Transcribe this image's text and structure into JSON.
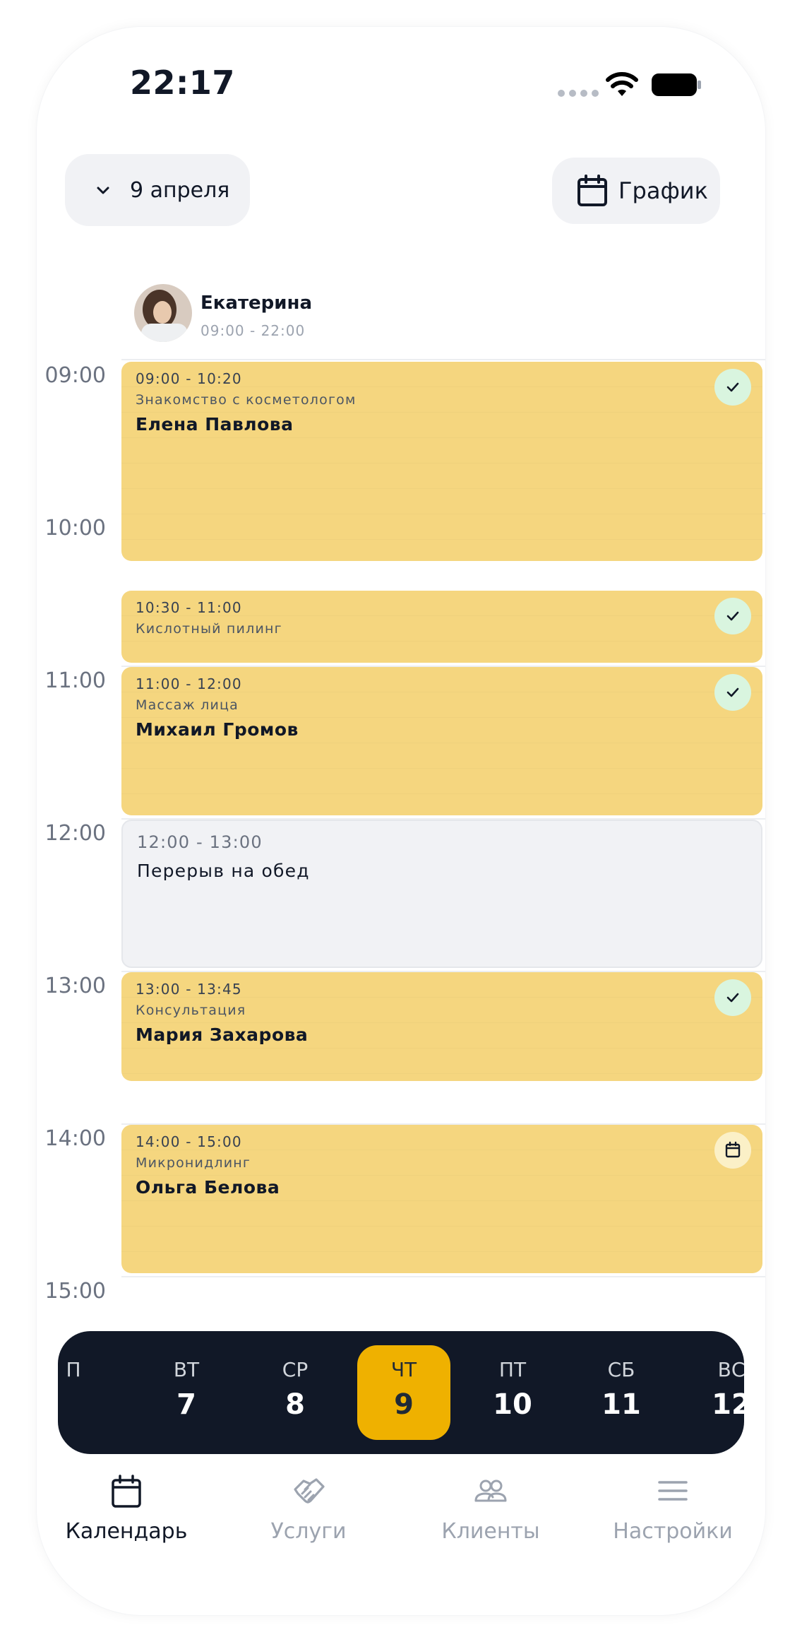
{
  "status_bar": {
    "time": "22:17"
  },
  "header": {
    "date_label": "9 апреля",
    "schedule_label": "График"
  },
  "staff": {
    "name": "Екатерина",
    "hours": "09:00 - 22:00"
  },
  "hours": [
    "09:00",
    "10:00",
    "11:00",
    "12:00",
    "13:00",
    "14:00",
    "15:00"
  ],
  "events": [
    {
      "time": "09:00 - 10:20",
      "service": "Знакомство с косметологом",
      "client": "Елена Павлова",
      "status": "confirmed"
    },
    {
      "time": "10:30 - 11:00",
      "service": "Кислотный пилинг",
      "client": "",
      "status": "confirmed"
    },
    {
      "time": "11:00 - 12:00",
      "service": "Массаж лица",
      "client": "Михаил Громов",
      "status": "confirmed"
    },
    {
      "time": "12:00 - 13:00",
      "service": "Перерыв на обед",
      "client": "",
      "status": "break"
    },
    {
      "time": "13:00 - 13:45",
      "service": "Консультация",
      "client": "Мария Захарова",
      "status": "confirmed"
    },
    {
      "time": "14:00 - 15:00",
      "service": "Микронидлинг",
      "client": "Ольга Белова",
      "status": "scheduled"
    }
  ],
  "week": [
    {
      "dow": "П",
      "num": ""
    },
    {
      "dow": "ВТ",
      "num": "7"
    },
    {
      "dow": "СР",
      "num": "8"
    },
    {
      "dow": "ЧТ",
      "num": "9"
    },
    {
      "dow": "ПТ",
      "num": "10"
    },
    {
      "dow": "СБ",
      "num": "11"
    },
    {
      "dow": "ВС",
      "num": "12"
    }
  ],
  "tabs": [
    {
      "label": "Календарь",
      "icon": "calendar-icon"
    },
    {
      "label": "Услуги",
      "icon": "handshake-icon"
    },
    {
      "label": "Клиенты",
      "icon": "users-icon"
    },
    {
      "label": "Настройки",
      "icon": "menu-icon"
    }
  ],
  "colors": {
    "event": "#f5d67f",
    "active_day": "#efb100",
    "strip": "#111827",
    "confirmed_badge": "#d9f5df"
  }
}
